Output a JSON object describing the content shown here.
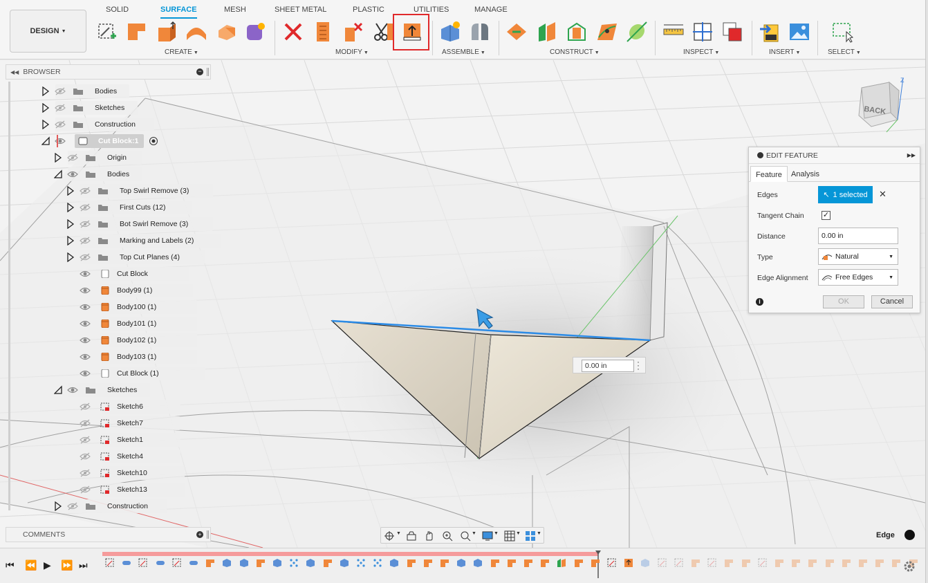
{
  "toolbar": {
    "workspace": "DESIGN",
    "tabs": [
      "SOLID",
      "SURFACE",
      "MESH",
      "SHEET METAL",
      "PLASTIC",
      "UTILITIES",
      "MANAGE"
    ],
    "active_tab": "SURFACE",
    "groups": [
      "CREATE",
      "MODIFY",
      "ASSEMBLE",
      "CONSTRUCT",
      "INSPECT",
      "INSERT",
      "SELECT"
    ],
    "highlight_color": "#e0292b",
    "accent_color": "#0696d7"
  },
  "browser": {
    "title": "BROWSER",
    "items": [
      {
        "label": "Bodies",
        "icon": "folder-icon"
      },
      {
        "label": "Sketches",
        "icon": "folder-icon"
      },
      {
        "label": "Construction",
        "icon": "folder-icon"
      },
      {
        "label": "Cut Block:1",
        "icon": "component-icon"
      },
      {
        "label": "Origin",
        "icon": "folder-icon"
      },
      {
        "label": "Bodies",
        "icon": "folder-icon"
      },
      {
        "label": "Top Swirl Remove (3)",
        "icon": "folder-icon"
      },
      {
        "label": "First Cuts (12)",
        "icon": "folder-icon"
      },
      {
        "label": "Bot Swirl Remove (3)",
        "icon": "folder-icon"
      },
      {
        "label": "Marking and Labels (2)",
        "icon": "folder-icon"
      },
      {
        "label": "Top Cut Planes (4)",
        "icon": "folder-icon"
      },
      {
        "label": "Cut Block",
        "icon": "body-icon"
      },
      {
        "label": "Body99 (1)",
        "icon": "body-icon"
      },
      {
        "label": "Body100 (1)",
        "icon": "body-icon"
      },
      {
        "label": "Body101 (1)",
        "icon": "body-icon"
      },
      {
        "label": "Body102 (1)",
        "icon": "body-icon"
      },
      {
        "label": "Body103 (1)",
        "icon": "body-icon"
      },
      {
        "label": "Cut Block (1)",
        "icon": "body-icon"
      },
      {
        "label": "Sketches",
        "icon": "folder-icon"
      },
      {
        "label": "Sketch6",
        "icon": "sketch-icon"
      },
      {
        "label": "Sketch7",
        "icon": "sketch-icon"
      },
      {
        "label": "Sketch1",
        "icon": "sketch-icon"
      },
      {
        "label": "Sketch4",
        "icon": "sketch-icon"
      },
      {
        "label": "Sketch10",
        "icon": "sketch-icon"
      },
      {
        "label": "Sketch13",
        "icon": "sketch-icon"
      },
      {
        "label": "Construction",
        "icon": "folder-icon"
      }
    ]
  },
  "comments": {
    "title": "COMMENTS"
  },
  "edit_feature": {
    "title": "EDIT FEATURE",
    "tabs": [
      "Feature",
      "Analysis"
    ],
    "active_tab": "Feature",
    "edges_label": "Edges",
    "edges_value": "1 selected",
    "tangent_label": "Tangent Chain",
    "tangent_checked": "✓",
    "distance_label": "Distance",
    "distance_value": "0.00 in",
    "type_label": "Type",
    "type_value": "Natural",
    "alignment_label": "Edge Alignment",
    "alignment_value": "Free Edges",
    "ok": "OK",
    "cancel": "Cancel"
  },
  "manipulator": {
    "value": "0.00 in"
  },
  "viewcube": {
    "face": "BACK",
    "axis": "Z"
  },
  "status": {
    "selection_filter": "Edge"
  }
}
